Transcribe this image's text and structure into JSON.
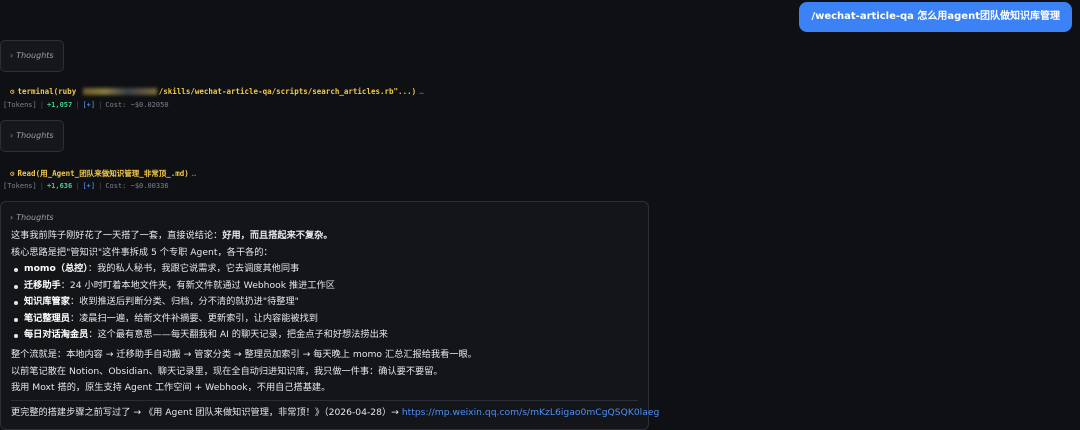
{
  "user_message": "/wechat-article-qa 怎么用agent团队做知识库管理",
  "thoughts_label": "Thoughts",
  "thoughts_chevron": "›",
  "tool_calls": [
    {
      "command_prefix": "terminal(ruby ",
      "command_suffix": "/skills/wechat-article-qa/scripts/search_articles.rb\"...)",
      "ellipsis": "…",
      "tokens_label": "[Tokens]",
      "tokens_delta": "+1,057",
      "expand_label": "[+]",
      "cost": "Cost: ~$0.02050"
    },
    {
      "command_prefix": "Read(用_Agent_团队来做知识管理_非常顶_.md)",
      "command_suffix": "",
      "ellipsis": "…",
      "tokens_label": "[Tokens]",
      "tokens_delta": "+1,636",
      "expand_label": "[+]",
      "cost": "Cost: ~$0.00336"
    }
  ],
  "answer": {
    "thoughts_label": "Thoughts",
    "intro_line1_a": "这事我前阵子刚好花了一天搭了一套，直接说结论：",
    "intro_line1_b": "好用，而且搭起来不复杂。",
    "intro_line2": "核心思路是把\"管知识\"这件事拆成 5 个专职 Agent，各干各的：",
    "bullets": [
      {
        "title": "momo（总控）",
        "text": "：我的私人秘书，我跟它说需求，它去调度其他同事"
      },
      {
        "title": "迁移助手",
        "text": "：24 小时盯着本地文件夹，有新文件就通过 Webhook 推进工作区"
      },
      {
        "title": "知识库管家",
        "text": "：收到推送后判断分类、归档，分不清的就扔进\"待整理\""
      },
      {
        "title": "笔记整理员",
        "text": "：凌晨扫一遍，给新文件补摘要、更新索引，让内容能被找到"
      },
      {
        "title": "每日对话淘金员",
        "text": "：这个最有意思——每天翻我和 AI 的聊天记录，把金点子和好想法捞出来"
      }
    ],
    "flow_line": "整个流就是：本地内容 → 迁移助手自动搬 → 管家分类 → 整理员加索引 → 每天晚上 momo 汇总汇报给我看一眼。",
    "before_line": "以前笔记散在 Notion、Obsidian、聊天记录里，现在全自动归进知识库，我只做一件事：确认要不要留。",
    "moxt_line": "我用 Moxt 搭的，原生支持 Agent 工作空间 + Webhook，不用自己搭基建。",
    "footer_text": "更完整的搭建步骤之前写过了 → 《用 Agent 团队来做知识管理，非常顶！》（2026-04-28）→ ",
    "footer_link": "https://mp.weixin.qq.com/s/mKzL6igao0mCgQSQK0laeg"
  }
}
